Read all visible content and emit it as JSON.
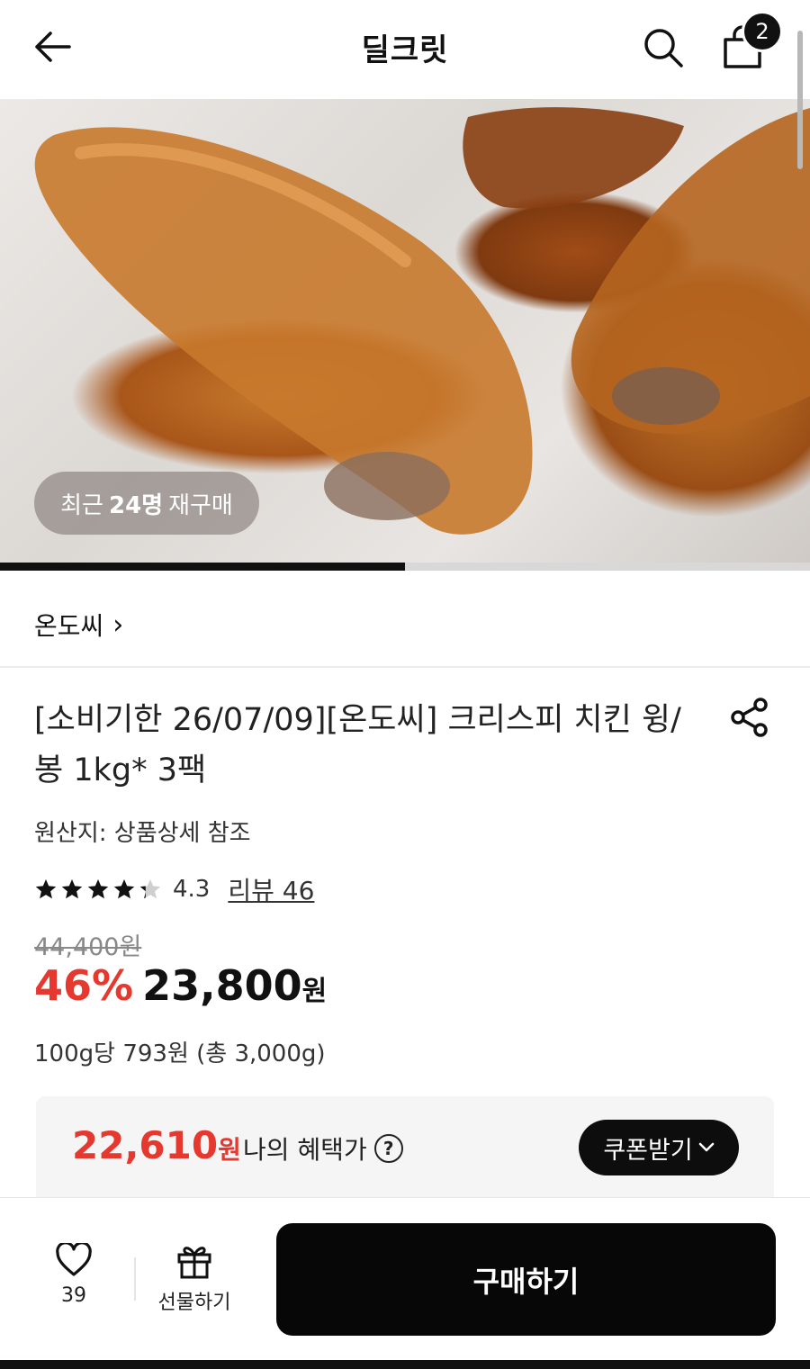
{
  "header": {
    "title": "딜크릿",
    "cart_count": "2"
  },
  "hero": {
    "rebuy_prefix": "최근",
    "rebuy_count": "24명",
    "rebuy_suffix": "재구매",
    "image_progress": 0.5
  },
  "brand": {
    "name": "온도씨",
    "chevron": "›"
  },
  "product": {
    "title": "[소비기한 26/07/09][온도씨] 크리스피 치킨 윙/봉 1kg* 3팩",
    "origin": "원산지: 상품상세 참조",
    "rating": "4.3",
    "rating_value": 4.3,
    "review_link": "리뷰 46",
    "original_price": "44,400원",
    "discount": "46%",
    "sale_price": "23,800",
    "sale_unit": "원",
    "unit_price": "100g당 793원 (총 3,000g)"
  },
  "benefit": {
    "price": "22,610",
    "price_unit": "원",
    "label": "나의 혜택가",
    "help": "?",
    "coupon_button": "쿠폰받기"
  },
  "bottom": {
    "like_count": "39",
    "gift_label": "선물하기",
    "buy_label": "구매하기"
  },
  "icons": {
    "back": "arrow-left-icon",
    "search": "search-icon",
    "cart": "shopping-bag-icon",
    "share": "share-icon",
    "like": "heart-icon",
    "gift": "gift-icon",
    "coupon": "chevron-down-icon",
    "star": "star-icon"
  },
  "colors": {
    "accent_red": "#e5392f",
    "primary_black": "#070707",
    "benefit_bg": "#f5f5f5"
  }
}
